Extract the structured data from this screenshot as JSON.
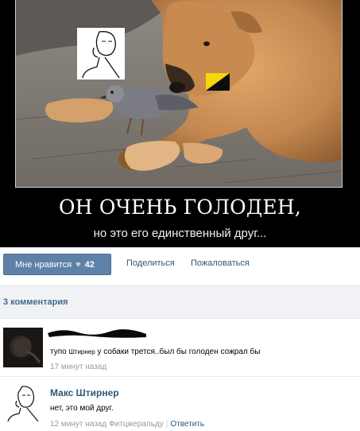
{
  "poster": {
    "title": "ОН ОЧЕНЬ ГОЛОДЕН,",
    "caption": "но это его единственный друг..."
  },
  "actions": {
    "like_label": "Мне нравится",
    "like_count": "42",
    "share_label": "Поделиться",
    "report_label": "Пожаловаться"
  },
  "comments_header": "3 комментария",
  "comments": [
    {
      "text_before": "тупо ",
      "text_mention": "Штирнер",
      "text_after": " у собаки трется..был бы голоден сожрал бы",
      "time": "17 минут назад"
    },
    {
      "author": "Макс Штирнер",
      "text": "нет, это мой друг.",
      "time": "12 минут назад",
      "reply_to": "Фитцжеральду",
      "reply_label": "Ответить"
    }
  ],
  "colors": {
    "like_button": "#5e81a8",
    "link": "#2b587a",
    "header_bg": "#f0f2f5",
    "meta_text": "#999999"
  }
}
